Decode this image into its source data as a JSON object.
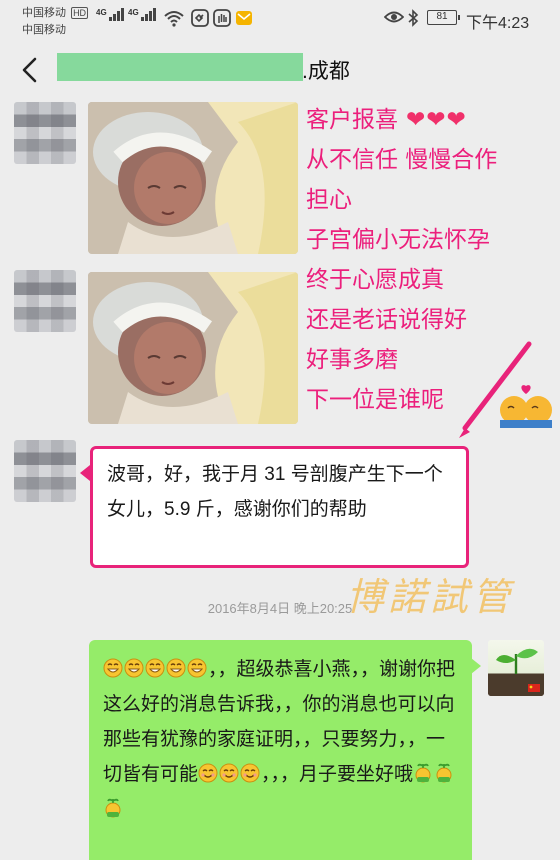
{
  "status_bar": {
    "carrier_1": "中国移动",
    "carrier_1_badge": "HD",
    "carrier_2": "中国移动",
    "network_1": "4G",
    "network_2": "4G",
    "battery": "81",
    "time": "下午4:23"
  },
  "chat": {
    "title_suffix": ".成都"
  },
  "caption": {
    "lines": [
      "客户报喜",
      "从不信任 慢慢合作",
      "担心",
      "子宫偏小无法怀孕",
      "终于心愿成真",
      "还是老话说得好",
      "好事多磨",
      "下一位是谁呢"
    ],
    "hearts": "❤❤❤"
  },
  "messages": {
    "incoming_text": "波哥，好，我于月 31 号剖腹产生下一个女儿，5.9 斤，感谢你们的帮助",
    "timestamp": "2016年8月4日 晚上20:25",
    "outgoing_part1": "，，超级恭喜小燕，，谢谢你把这么好的消息告诉我，，你的消息也可以向那些有犹豫的家庭证明，，只要努力，，一切皆有可能",
    "outgoing_part2": "，，，月子要坐好哦"
  },
  "watermark": "博諾試管",
  "colors": {
    "caption_pink": "#ec1f7c",
    "bubble_green": "#95ec69",
    "highlight_border": "#e8237a",
    "background": "#ededed"
  }
}
